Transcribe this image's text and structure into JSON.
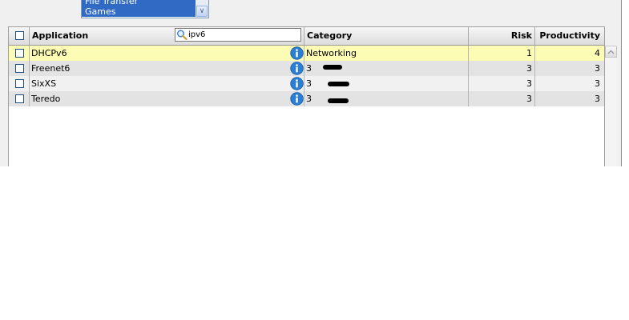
{
  "category_list": {
    "options": [
      "File Transfer",
      "Games"
    ],
    "scroll_down_glyph": "∨"
  },
  "grid": {
    "columns": {
      "application": "Application",
      "category": "Category",
      "risk": "Risk",
      "productivity": "Productivity"
    },
    "search": {
      "value": "ipv6",
      "placeholder": ""
    },
    "rows": [
      {
        "application": "DHCPv6",
        "category": "Networking",
        "risk": "1",
        "productivity": "4",
        "state": "selected"
      },
      {
        "application": "Freenet6",
        "category": "3",
        "risk": "3",
        "productivity": "3",
        "state": "odd"
      },
      {
        "application": "SixXS",
        "category": "3",
        "risk": "3",
        "productivity": "3",
        "state": "even"
      },
      {
        "application": "Teredo",
        "category": "3",
        "risk": "3",
        "productivity": "3",
        "state": "odd"
      }
    ]
  },
  "colors": {
    "selected_row": "#fcfcb4",
    "listbox_selection": "#316ac5",
    "info_icon": "#2a7fd4"
  },
  "icons": {
    "search": "magnifier-icon",
    "info": "info-icon",
    "scroll_up": "chevron-up-icon"
  }
}
